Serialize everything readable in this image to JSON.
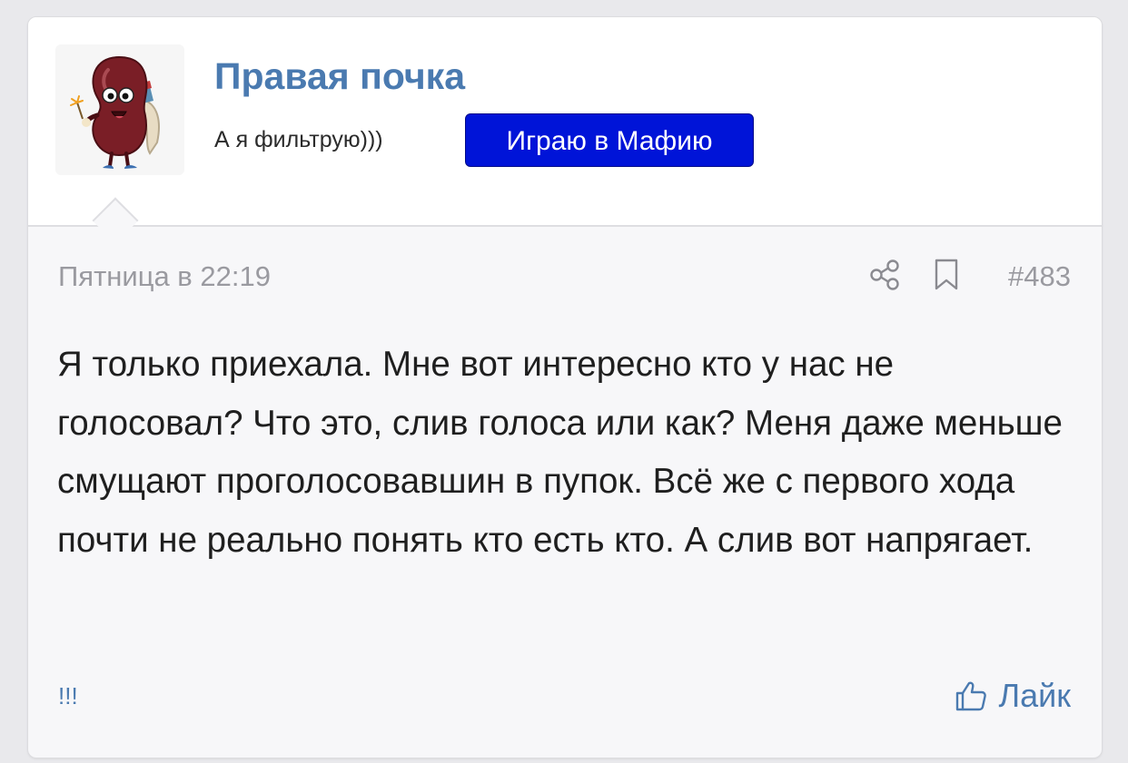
{
  "post": {
    "author": "Правая почка",
    "status_text": "А я фильтрую)))",
    "role_badge": "Играю в Мафию",
    "timestamp": "Пятница в 22:19",
    "post_number": "#483",
    "message": "Я только приехала. Мне вот интересно кто у нас не голосовал? Что это, слив голоса или как? Меня даже меньше смущают проголосовавшин в пупок. Всё же с первого хода почти не реально понять кто есть кто. А слив вот напрягает.",
    "footer_left": "!!!",
    "like_label": "Лайк"
  },
  "icons": {
    "share": "share-icon",
    "bookmark": "bookmark-icon",
    "like": "thumbs-up-icon",
    "avatar": "kidney-character-avatar"
  },
  "colors": {
    "author_link": "#4a7ab0",
    "badge_bg": "#0014d8",
    "badge_text": "#ffffff",
    "meta_text": "#9a9aa0",
    "body_text": "#1f1f1f"
  }
}
